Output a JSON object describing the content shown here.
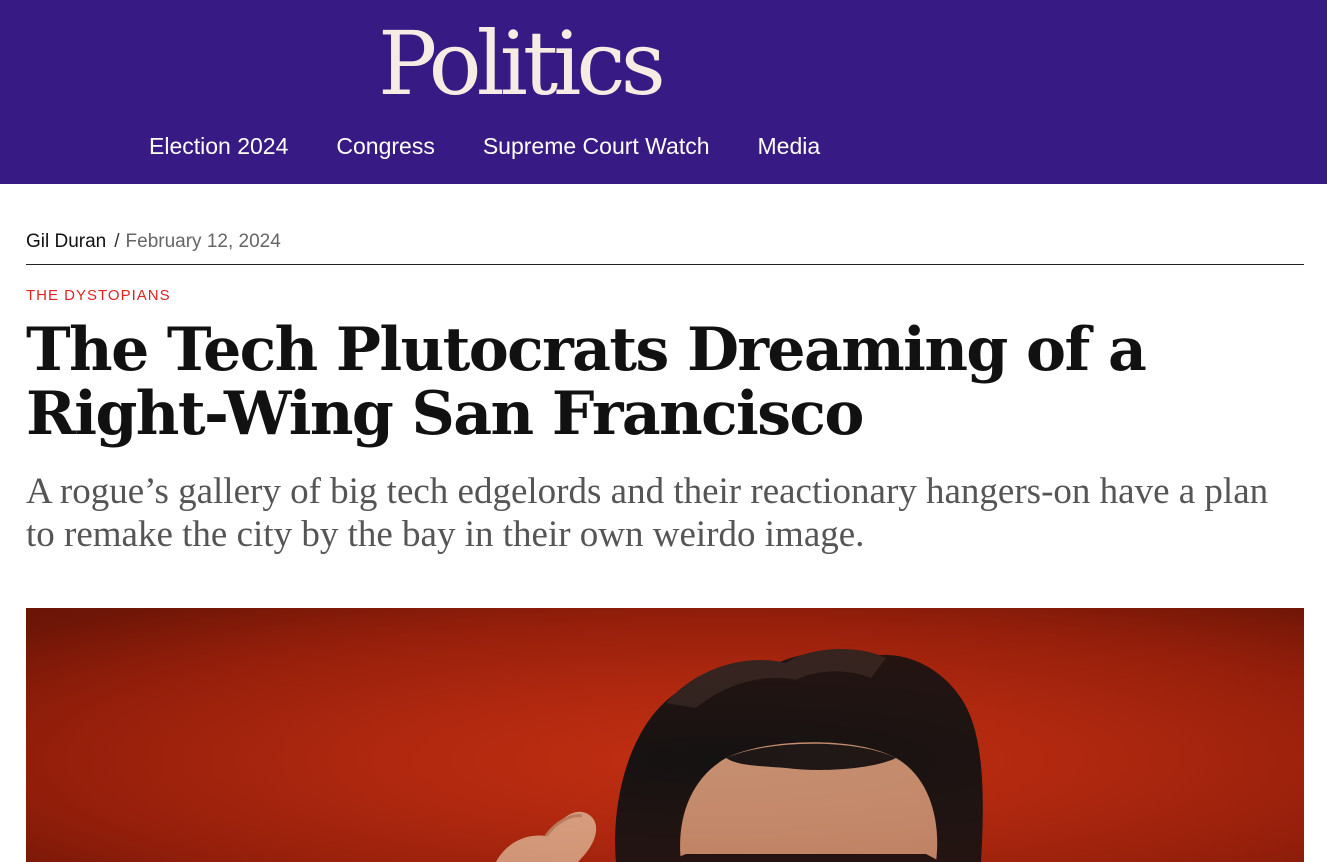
{
  "site": {
    "section_title": "Politics",
    "brand_color": "#371a84"
  },
  "nav": {
    "items": [
      {
        "label": "Election 2024"
      },
      {
        "label": "Congress"
      },
      {
        "label": "Supreme Court Watch"
      },
      {
        "label": "Media"
      }
    ]
  },
  "article": {
    "author": "Gil Duran",
    "separator": "/",
    "date": "February 12, 2024",
    "kicker": "THE DYSTOPIANS",
    "kicker_color": "#e02424",
    "headline": "The Tech Plutocrats Dreaming of a Right-Wing San Francisco",
    "dek": "A rogue’s gallery of big tech edgelords and their reactionary hangers-on have a plan to remake the city by the bay in their own weirdo image."
  },
  "hero_image": {
    "subject": "man with dark hair against a red background, hand raised to glasses",
    "background_color": "#b0280f"
  }
}
